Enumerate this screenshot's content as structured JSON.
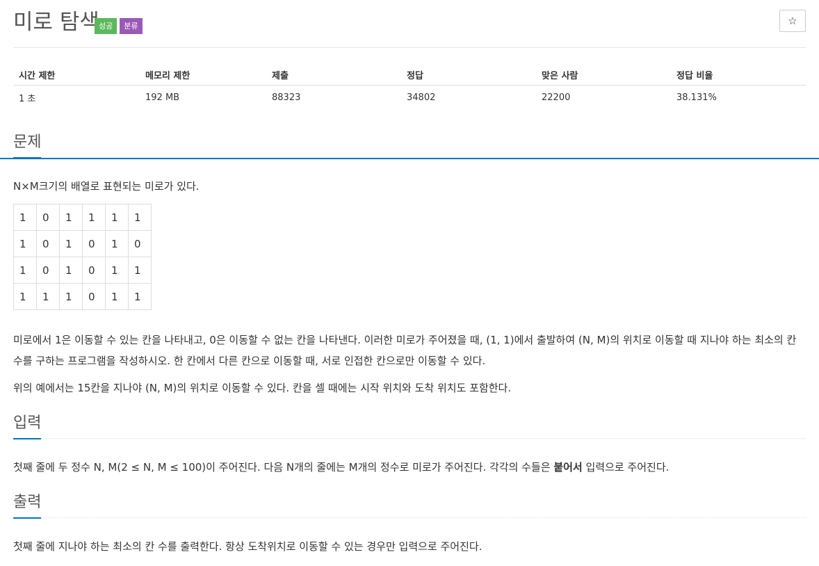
{
  "problem": {
    "title": "미로 탐색",
    "badges": [
      {
        "label": "성공",
        "color": "#5cb85c"
      },
      {
        "label": "분류",
        "color": "#9b59b6"
      }
    ],
    "star_icon": "☆"
  },
  "info_table": {
    "headers": [
      "시간 제한",
      "메모리 제한",
      "제출",
      "정답",
      "맞은 사람",
      "정답 비율"
    ],
    "values": [
      "1 초",
      "192 MB",
      "88323",
      "34802",
      "22200",
      "38.131%"
    ]
  },
  "sections": {
    "problem": {
      "heading": "문제",
      "intro": "N×M크기의 배열로 표현되는 미로가 있다.",
      "maze": [
        [
          "1",
          "0",
          "1",
          "1",
          "1",
          "1"
        ],
        [
          "1",
          "0",
          "1",
          "0",
          "1",
          "0"
        ],
        [
          "1",
          "0",
          "1",
          "0",
          "1",
          "1"
        ],
        [
          "1",
          "1",
          "1",
          "0",
          "1",
          "1"
        ]
      ],
      "para1": "미로에서 1은 이동할 수 있는 칸을 나타내고, 0은 이동할 수 없는 칸을 나타낸다. 이러한 미로가 주어졌을 때, (1, 1)에서 출발하여 (N, M)의 위치로 이동할 때 지나야 하는 최소의 칸 수를 구하는 프로그램을 작성하시오. 한 칸에서 다른 칸으로 이동할 때, 서로 인접한 칸으로만 이동할 수 있다.",
      "para2": "위의 예에서는 15칸을 지나야 (N, M)의 위치로 이동할 수 있다. 칸을 셀 때에는 시작 위치와 도착 위치도 포함한다."
    },
    "input": {
      "heading": "입력",
      "text_before": "첫째 줄에 두 정수 N, M(2 ≤ N, M ≤ 100)이 주어진다. 다음 N개의 줄에는 M개의 정수로 미로가 주어진다. 각각의 수들은 ",
      "text_bold": "붙어서",
      "text_after": " 입력으로 주어진다."
    },
    "output": {
      "heading": "출력",
      "text": "첫째 줄에 지나야 하는 최소의 칸 수를 출력한다. 항상 도착위치로 이동할 수 있는 경우만 입력으로 주어진다."
    }
  }
}
